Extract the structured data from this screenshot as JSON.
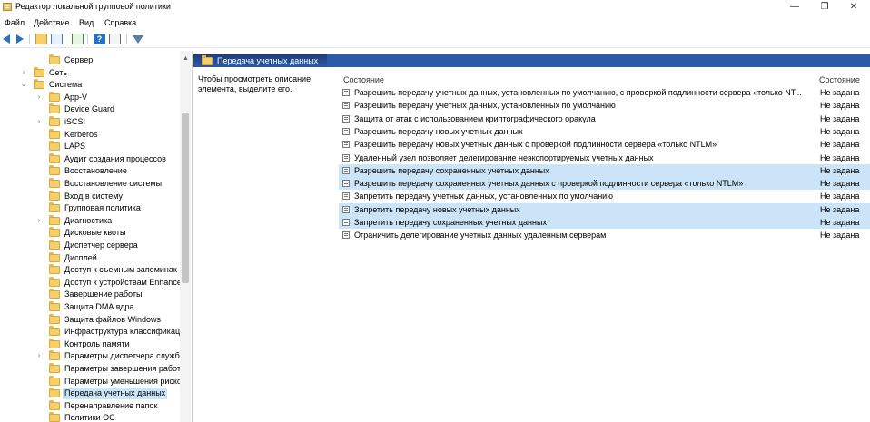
{
  "window": {
    "title": "Редактор локальной групповой политики",
    "min_glyph": "—",
    "max_glyph": "❐",
    "close_glyph": "✕"
  },
  "menu": [
    "Файл",
    "Действие",
    "Вид",
    "Справка"
  ],
  "tree": {
    "items": [
      {
        "label": "Сервер",
        "level": 2,
        "expander": ""
      },
      {
        "label": "Сеть",
        "level": 1,
        "expander": "›"
      },
      {
        "label": "Система",
        "level": 1,
        "expander": "⌄"
      },
      {
        "label": "App-V",
        "level": 2,
        "expander": "›"
      },
      {
        "label": "Device Guard",
        "level": 2,
        "expander": ""
      },
      {
        "label": "iSCSI",
        "level": 2,
        "expander": "›"
      },
      {
        "label": "Kerberos",
        "level": 2,
        "expander": ""
      },
      {
        "label": "LAPS",
        "level": 2,
        "expander": ""
      },
      {
        "label": "Аудит создания процессов",
        "level": 2,
        "expander": ""
      },
      {
        "label": "Восстановление",
        "level": 2,
        "expander": ""
      },
      {
        "label": "Восстановление системы",
        "level": 2,
        "expander": ""
      },
      {
        "label": "Вход в систему",
        "level": 2,
        "expander": ""
      },
      {
        "label": "Групповая политика",
        "level": 2,
        "expander": ""
      },
      {
        "label": "Диагностика",
        "level": 2,
        "expander": "›"
      },
      {
        "label": "Дисковые квоты",
        "level": 2,
        "expander": ""
      },
      {
        "label": "Диспетчер сервера",
        "level": 2,
        "expander": ""
      },
      {
        "label": "Дисплей",
        "level": 2,
        "expander": ""
      },
      {
        "label": "Доступ к съемным запоминак",
        "level": 2,
        "expander": ""
      },
      {
        "label": "Доступ к устройствам Enhance",
        "level": 2,
        "expander": ""
      },
      {
        "label": "Завершение работы",
        "level": 2,
        "expander": ""
      },
      {
        "label": "Защита DMA ядра",
        "level": 2,
        "expander": ""
      },
      {
        "label": "Защита файлов Windows",
        "level": 2,
        "expander": ""
      },
      {
        "label": "Инфраструктура классификац",
        "level": 2,
        "expander": ""
      },
      {
        "label": "Контроль памяти",
        "level": 2,
        "expander": ""
      },
      {
        "label": "Параметры диспетчера служб",
        "level": 2,
        "expander": "›"
      },
      {
        "label": "Параметры завершения работ",
        "level": 2,
        "expander": ""
      },
      {
        "label": "Параметры уменьшения риско",
        "level": 2,
        "expander": ""
      },
      {
        "label": "Передача учетных данных",
        "level": 2,
        "expander": "",
        "selected": true
      },
      {
        "label": "Перенаправление папок",
        "level": 2,
        "expander": ""
      },
      {
        "label": "Политики ОС",
        "level": 2,
        "expander": ""
      }
    ]
  },
  "panel": {
    "title": "Передача учетных данных",
    "description": "Чтобы просмотреть описание элемента, выделите его.",
    "col_setting": "Состояние",
    "col_state": "Состояние"
  },
  "policies": [
    {
      "name": "Разрешить передачу учетных данных, установленных по умолчанию, с проверкой подлинности сервера «только NT...",
      "state": "Не задана",
      "hl": false
    },
    {
      "name": "Разрешить передачу учетных данных, установленных по умолчанию",
      "state": "Не задана",
      "hl": false
    },
    {
      "name": "Защита от атак с использованием криптографического оракула",
      "state": "Не задана",
      "hl": false
    },
    {
      "name": "Разрешить передачу новых учетных данных",
      "state": "Не задана",
      "hl": false
    },
    {
      "name": "Разрешить передачу новых учетных данных с проверкой подлинности сервера «только NTLM»",
      "state": "Не задана",
      "hl": false
    },
    {
      "name": "Удаленный узел позволяет делегирование неэкспортируемых учетных данных",
      "state": "Не задана",
      "hl": false
    },
    {
      "name": "Разрешить передачу сохраненных учетных данных",
      "state": "Не задана",
      "hl": true
    },
    {
      "name": "Разрешить передачу сохраненных учетных данных с проверкой подлинности сервера «только NTLM»",
      "state": "Не задана",
      "hl": true
    },
    {
      "name": "Запретить передачу учетных данных, установленных по умолчанию",
      "state": "Не задана",
      "hl": false
    },
    {
      "name": "Запретить передачу новых учетных данных",
      "state": "Не задана",
      "hl": true
    },
    {
      "name": "Запретить передачу сохраненных учетных данных",
      "state": "Не задана",
      "hl": true
    },
    {
      "name": "Ограничить делегирование учетных данных удаленным серверам",
      "state": "Не задана",
      "hl": false
    }
  ],
  "toolbar_icons": [
    "back-icon",
    "forward-icon",
    "up-folder-icon",
    "show-hide-tree-icon",
    "export-list-icon",
    "help-icon",
    "properties-icon",
    "filter-icon"
  ],
  "colors": {
    "accent": "#2b5aa8",
    "selection": "#cce4f7"
  }
}
